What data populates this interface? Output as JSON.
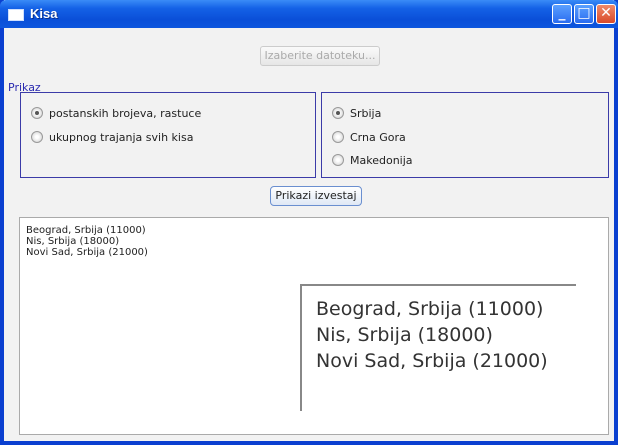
{
  "window": {
    "title": "Kisa",
    "controls": {
      "minimize": "_",
      "maximize": "□",
      "close": "✕"
    }
  },
  "file_button": {
    "label": "Izaberite datoteku..."
  },
  "prikaz": {
    "label": "Prikaz",
    "sort_options": [
      {
        "label": "postanskih brojeva, rastuce",
        "selected": true
      },
      {
        "label": "ukupnog trajanja svih kisa",
        "selected": false
      }
    ],
    "country_options": [
      {
        "label": "Srbija",
        "selected": true
      },
      {
        "label": "Crna Gora",
        "selected": false
      },
      {
        "label": "Makedonija",
        "selected": false
      }
    ]
  },
  "show_button": {
    "label": "Prikazi izvestaj"
  },
  "report": {
    "lines": [
      "Beograd, Srbija (11000)",
      "Nis, Srbija (18000)",
      "Novi Sad, Srbija (21000)"
    ]
  }
}
